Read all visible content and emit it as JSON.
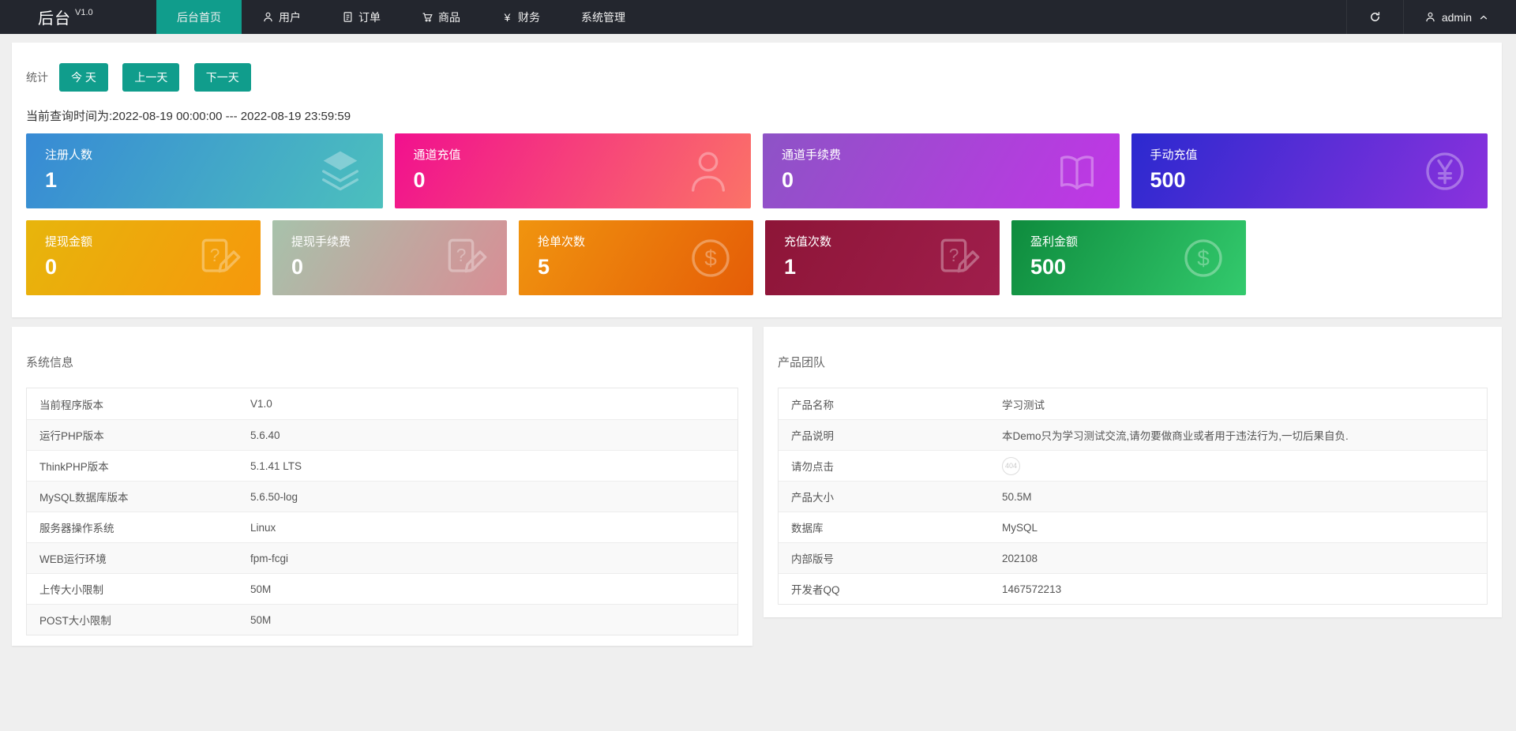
{
  "navbar": {
    "logo": "后台",
    "logo_version": "V1.0",
    "menu": [
      {
        "label": "后台首页",
        "icon": "",
        "active": true
      },
      {
        "label": "用户",
        "icon": "user-icon",
        "active": false
      },
      {
        "label": "订单",
        "icon": "order-icon",
        "active": false
      },
      {
        "label": "商品",
        "icon": "cart-icon",
        "active": false
      },
      {
        "label": "财务",
        "icon": "yen-icon",
        "active": false
      },
      {
        "label": "系统管理",
        "icon": "",
        "active": false
      }
    ],
    "username": "admin"
  },
  "stats": {
    "label": "统计",
    "range_buttons": [
      "今 天",
      "上一天",
      "下一天"
    ],
    "query_time": "当前查询时间为:2022-08-19 00:00:00 --- 2022-08-19 23:59:59",
    "cards_row1": [
      {
        "title": "注册人数",
        "value": "1",
        "icon": "layers-icon",
        "color_from": "#378ad5",
        "color_to": "#4cc0bd"
      },
      {
        "title": "通道充值",
        "value": "0",
        "icon": "person-icon",
        "color_from": "#f1108e",
        "color_to": "#fb7367"
      },
      {
        "title": "通道手续费",
        "value": "0",
        "icon": "book-icon",
        "color_from": "#8d53c6",
        "color_to": "#c136e6"
      },
      {
        "title": "手动充值",
        "value": "500",
        "icon": "yen-circle-icon",
        "color_from": "#2b29cf",
        "color_to": "#8b32dd"
      }
    ],
    "cards_row2": [
      {
        "title": "提现金额",
        "value": "0",
        "icon": "edit-question-icon",
        "color_from": "#e7b50c",
        "color_to": "#f6980c"
      },
      {
        "title": "提现手续费",
        "value": "0",
        "icon": "edit-question-icon",
        "color_from": "#a7c2ab",
        "color_to": "#d88e95"
      },
      {
        "title": "抢单次数",
        "value": "5",
        "icon": "dollar-circle-icon",
        "color_from": "#f0940f",
        "color_to": "#e55d07"
      },
      {
        "title": "充值次数",
        "value": "1",
        "icon": "edit-question-icon",
        "color_from": "#8d1537",
        "color_to": "#a01e4c"
      },
      {
        "title": "盈利金额",
        "value": "500",
        "icon": "dollar-circle-icon",
        "color_from": "#0e8b3d",
        "color_to": "#33ca6d"
      }
    ]
  },
  "system_info": {
    "title": "系统信息",
    "rows": [
      {
        "label": "当前程序版本",
        "value": "V1.0"
      },
      {
        "label": "运行PHP版本",
        "value": "5.6.40"
      },
      {
        "label": "ThinkPHP版本",
        "value": "5.1.41 LTS"
      },
      {
        "label": "MySQL数据库版本",
        "value": "5.6.50-log"
      },
      {
        "label": "服务器操作系统",
        "value": "Linux"
      },
      {
        "label": "WEB运行环境",
        "value": "fpm-fcgi"
      },
      {
        "label": "上传大小限制",
        "value": "50M"
      },
      {
        "label": "POST大小限制",
        "value": "50M"
      }
    ]
  },
  "product_team": {
    "title": "产品团队",
    "rows": [
      {
        "label": "产品名称",
        "value": "学习测试"
      },
      {
        "label": "产品说明",
        "value": "本Demo只为学习测试交流,请勿要做商业或者用于违法行为,一切后果自负."
      },
      {
        "label": "请勿点击",
        "value": "404",
        "badge": true
      },
      {
        "label": "产品大小",
        "value": "50.5M"
      },
      {
        "label": "数据库",
        "value": "MySQL"
      },
      {
        "label": "内部版号",
        "value": "202108"
      },
      {
        "label": "开发者QQ",
        "value": "1467572213"
      }
    ]
  },
  "colors": {
    "navbar_bg": "#23262e",
    "accent_green": "#109d8c",
    "page_bg": "#efefef"
  }
}
